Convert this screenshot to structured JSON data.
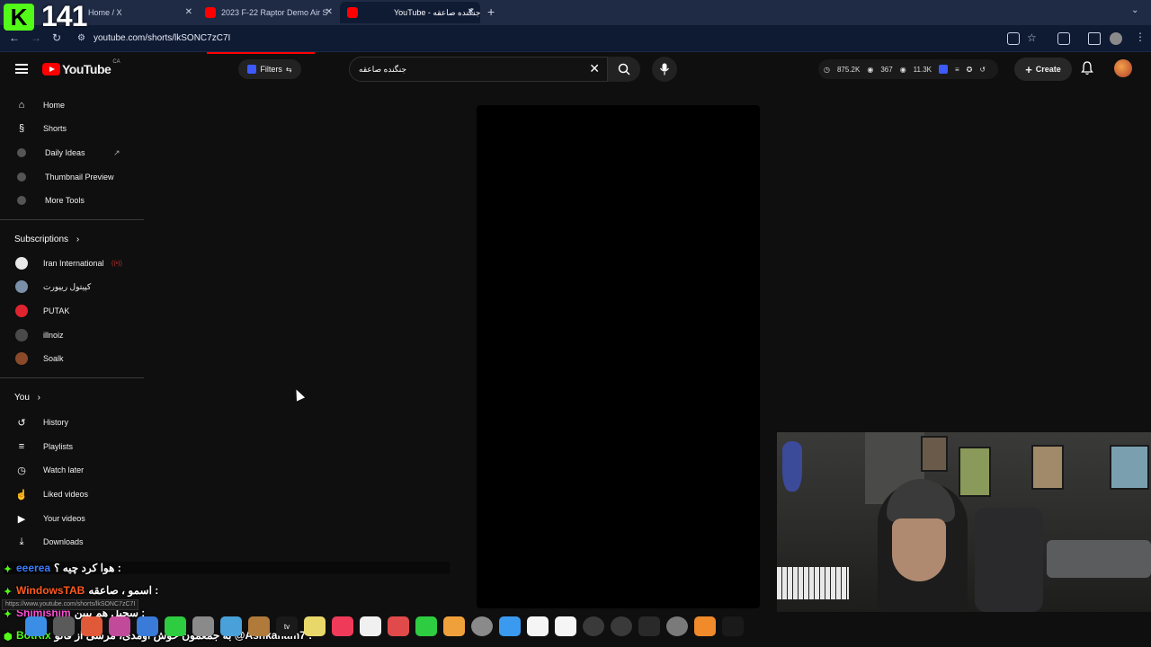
{
  "browser": {
    "tabs": [
      {
        "title": "Home / X",
        "favicon": "x-icon"
      },
      {
        "title": "2023 F-22 Raptor Demo Air S",
        "favicon": "youtube-icon"
      },
      {
        "title": "YouTube - جنگنده صاعقه",
        "favicon": "youtube-icon"
      }
    ],
    "new_tab": "+",
    "url": "youtube.com/shorts/lkSONC7zC7I"
  },
  "overlay": {
    "kick_letter": "K",
    "viewer_count": "141"
  },
  "youtube": {
    "logo_text": "YouTube",
    "country_code": "CA",
    "filters_label": "Filters",
    "search_value": "جنگنده صاعقه",
    "stats": {
      "a": "875.2K",
      "b": "367",
      "c": "11.3K"
    },
    "create_label": "Create"
  },
  "sidebar": {
    "main": [
      {
        "label": "Home",
        "icon": "home-icon"
      },
      {
        "label": "Shorts",
        "icon": "shorts-icon"
      },
      {
        "label": "Daily Ideas",
        "icon": "extension-icon"
      },
      {
        "label": "Thumbnail Preview",
        "icon": "extension-icon"
      },
      {
        "label": "More Tools",
        "icon": "extension-icon"
      }
    ],
    "subscriptions_header": "Subscriptions",
    "subscriptions": [
      {
        "label": "Iran International",
        "color": "#e8e8e8"
      },
      {
        "label": "کپیتول ریپورت",
        "color": "#7a8fa8"
      },
      {
        "label": "PUTAK",
        "color": "#e0242f"
      },
      {
        "label": "illnoiz",
        "color": "#4a4a4a"
      },
      {
        "label": "Soalk",
        "color": "#8a4a2a"
      }
    ],
    "you_header": "You",
    "you": [
      {
        "label": "History",
        "icon": "history-icon"
      },
      {
        "label": "Playlists",
        "icon": "playlists-icon"
      },
      {
        "label": "Watch later",
        "icon": "clock-icon"
      },
      {
        "label": "Liked videos",
        "icon": "thumbs-up-icon"
      },
      {
        "label": "Your videos",
        "icon": "video-icon"
      },
      {
        "label": "Downloads",
        "icon": "download-icon"
      }
    ]
  },
  "chat": [
    {
      "user": "eeerea",
      "user_color": "#3d7bff",
      "text": "هوا کرد چیه ؟ :"
    },
    {
      "user": "WindowsTAB",
      "user_color": "#ff5a1f",
      "text": "اسمو ، صاعقه :"
    },
    {
      "user": "Shimishim",
      "user_color": "#ff4fd8",
      "text": "سجیل هم ببین :"
    },
    {
      "user": "BotRix",
      "user_color": "#53fc18",
      "text": "به جمعمون خوش اومدی، مرسی از فالو @Ashkanam7 :"
    }
  ],
  "status_url": "https://www.youtube.com/shorts/lkSONC7zC7I",
  "colors": {
    "accent": "#ff0000",
    "kick": "#53fc18"
  }
}
